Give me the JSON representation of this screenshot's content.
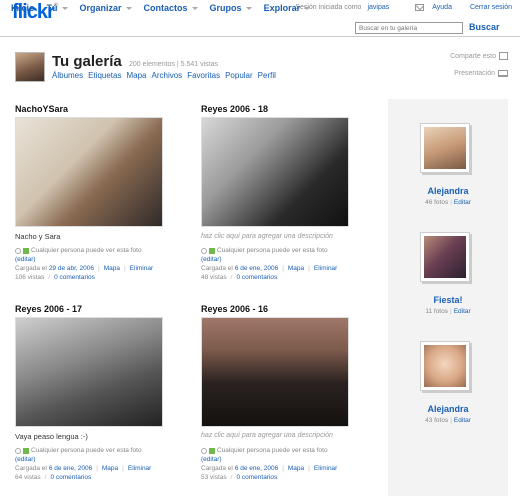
{
  "header": {
    "logo_main": "flickr",
    "logo_tm": "®",
    "session_text": "Sesión iniciada como",
    "username": "javipas",
    "help": "Ayuda",
    "logout": "Cerrar sesión"
  },
  "nav": {
    "items": [
      {
        "label": "Inicio",
        "dropdown": false
      },
      {
        "label": "Tú",
        "dropdown": true
      },
      {
        "label": "Organizar",
        "dropdown": true
      },
      {
        "label": "Contactos",
        "dropdown": true
      },
      {
        "label": "Grupos",
        "dropdown": true
      },
      {
        "label": "Explorar",
        "dropdown": true
      }
    ],
    "search_placeholder": "Buscar en tu galería",
    "search_button": "Buscar"
  },
  "profile": {
    "title": "Tu galería",
    "stats": "200 elementos | 5.541 vistas",
    "subnav": [
      "Álbumes",
      "Etiquetas",
      "Mapa",
      "Archivos",
      "Favoritas",
      "Popular",
      "Perfil"
    ],
    "share": "Comparte esto",
    "presentation": "Presentación"
  },
  "photos": [
    {
      "title": "NachoYSara",
      "caption": "Nacho y Sara",
      "add_desc": "",
      "privacy": "Cualquier persona puede ver esta foto",
      "edit": "(editar)",
      "uploaded_prefix": "Cargada el",
      "date": "29 de abr, 2006",
      "map": "Mapa",
      "delete": "Eliminar",
      "views": "106 vistas",
      "comments": "0 comentarios"
    },
    {
      "title": "Reyes 2006 - 18",
      "caption": "",
      "add_desc": "haz clic aquí para agregar una descripción",
      "privacy": "Cualquier persona puede ver esta foto",
      "edit": "(editar)",
      "uploaded_prefix": "Cargada el",
      "date": "6 de ene, 2006",
      "map": "Mapa",
      "delete": "Eliminar",
      "views": "48 vistas",
      "comments": "0 comentarios"
    },
    {
      "title": "Reyes 2006 - 17",
      "caption": "Vaya peaso lengua :-)",
      "add_desc": "",
      "privacy": "Cualquier persona puede ver esta foto",
      "edit": "(editar)",
      "uploaded_prefix": "Cargada el",
      "date": "6 de ene, 2006",
      "map": "Mapa",
      "delete": "Eliminar",
      "views": "64 vistas",
      "comments": "0 comentarios"
    },
    {
      "title": "Reyes 2006 - 16",
      "caption": "",
      "add_desc": "haz clic aquí para agregar una descripción",
      "privacy": "Cualquier persona puede ver esta foto",
      "edit": "(editar)",
      "uploaded_prefix": "Cargada el",
      "date": "6 de ene, 2006",
      "map": "Mapa",
      "delete": "Eliminar",
      "views": "53 vistas",
      "comments": "0 comentarios"
    }
  ],
  "sets": [
    {
      "name": "Alejandra",
      "count": "46 fotos",
      "edit": "Editar"
    },
    {
      "name": "Fiesta!",
      "count": "11 fotos",
      "edit": "Editar"
    },
    {
      "name": "Alejandra",
      "count": "43 fotos",
      "edit": "Editar"
    }
  ],
  "colors": {
    "link": "#1a5fb4",
    "flickr_blue": "#0063dc",
    "flickr_pink": "#ff0084",
    "public_green": "#6fb84a"
  }
}
